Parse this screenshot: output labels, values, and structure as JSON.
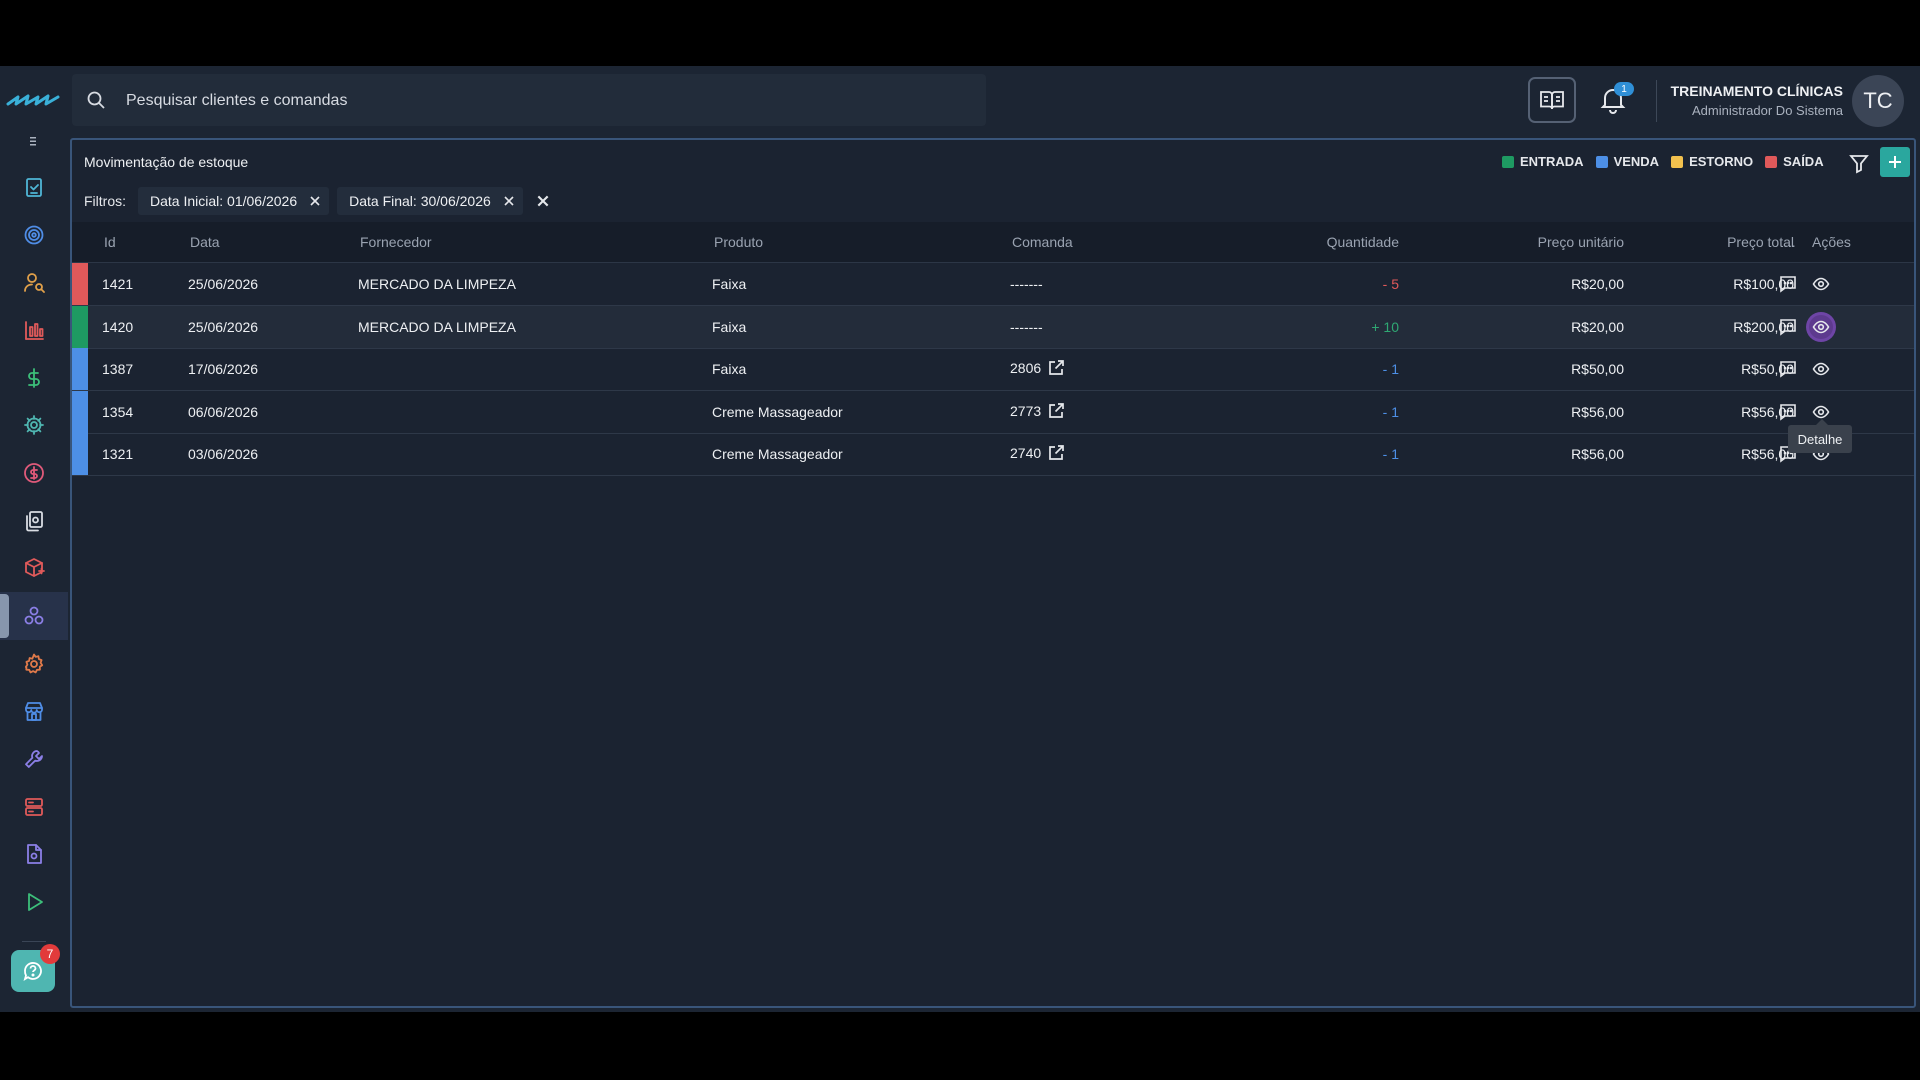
{
  "search": {
    "placeholder": "Pesquisar clientes e comandas",
    "value": ""
  },
  "header": {
    "notification_count": "1",
    "user_name": "TREINAMENTO CLÍNICAS",
    "user_role": "Administrador Do Sistema",
    "avatar_initials": "TC"
  },
  "sidebar": {
    "items": [
      {
        "icon": "checklist-icon",
        "color": "#4fb6d6"
      },
      {
        "icon": "target-icon",
        "color": "#4f8de6"
      },
      {
        "icon": "user-search-icon",
        "color": "#e0a04a"
      },
      {
        "icon": "bar-chart-icon",
        "color": "#e05a5a"
      },
      {
        "icon": "dollar-icon",
        "color": "#3cbf7a"
      },
      {
        "icon": "gear-icon",
        "color": "#4fb6b1"
      },
      {
        "icon": "coin-icon",
        "color": "#e05a7a"
      },
      {
        "icon": "documents-icon",
        "color": "#d9dde3"
      },
      {
        "icon": "box-plus-icon",
        "color": "#e05a5a"
      },
      {
        "icon": "molecule-icon",
        "color": "#8b7fe6",
        "active": true
      },
      {
        "icon": "cog-icon",
        "color": "#e07a4a"
      },
      {
        "icon": "store-icon",
        "color": "#4f8de6"
      },
      {
        "icon": "wrench-icon",
        "color": "#8b7fe6"
      },
      {
        "icon": "server-icon",
        "color": "#e05a5a"
      },
      {
        "icon": "file-icon",
        "color": "#8b7fe6"
      },
      {
        "icon": "play-icon",
        "color": "#3cbf7a"
      }
    ],
    "help_badge": "7"
  },
  "panel": {
    "title": "Movimentação de estoque",
    "legend": [
      {
        "label": "ENTRADA",
        "color": "#1e9a62"
      },
      {
        "label": "VENDA",
        "color": "#4d8fe6"
      },
      {
        "label": "ESTORNO",
        "color": "#f2c14e"
      },
      {
        "label": "SAÍDA",
        "color": "#e0595a"
      }
    ],
    "filters_label": "Filtros:",
    "filters": [
      "Data Inicial: 01/06/2026",
      "Data Final: 30/06/2026"
    ]
  },
  "table": {
    "columns": [
      "Id",
      "Data",
      "Fornecedor",
      "Produto",
      "Comanda",
      "Quantidade",
      "Preço unitário",
      "Preço total",
      "...",
      "Ações"
    ],
    "rows": [
      {
        "id": "1421",
        "date": "25/06/2026",
        "supplier": "MERCADO DA LIMPEZA",
        "product": "Faixa",
        "order": "-------",
        "has_link": false,
        "qty": "- 5",
        "unit": "R$20,00",
        "total": "R$100,00",
        "type_color": "#e0595a",
        "qty_class": "qty-neg-red"
      },
      {
        "id": "1420",
        "date": "25/06/2026",
        "supplier": "MERCADO DA LIMPEZA",
        "product": "Faixa",
        "order": "-------",
        "has_link": false,
        "qty": "+ 10",
        "unit": "R$20,00",
        "total": "R$200,00",
        "type_color": "#1e9a62",
        "qty_class": "qty-pos",
        "hover": true
      },
      {
        "id": "1387",
        "date": "17/06/2026",
        "supplier": "",
        "product": "Faixa",
        "order": "2806",
        "has_link": true,
        "qty": "- 1",
        "unit": "R$50,00",
        "total": "R$50,00",
        "type_color": "#4d8fe6",
        "qty_class": "qty-neg-blue"
      },
      {
        "id": "1354",
        "date": "06/06/2026",
        "supplier": "",
        "product": "Creme Massageador",
        "order": "2773",
        "has_link": true,
        "qty": "- 1",
        "unit": "R$56,00",
        "total": "R$56,00",
        "type_color": "#4d8fe6",
        "qty_class": "qty-neg-blue"
      },
      {
        "id": "1321",
        "date": "03/06/2026",
        "supplier": "",
        "product": "Creme Massageador",
        "order": "2740",
        "has_link": true,
        "qty": "- 1",
        "unit": "R$56,00",
        "total": "R$56,00",
        "type_color": "#4d8fe6",
        "qty_class": "qty-neg-blue"
      }
    ]
  },
  "tooltip": {
    "text": "Detalhe"
  }
}
